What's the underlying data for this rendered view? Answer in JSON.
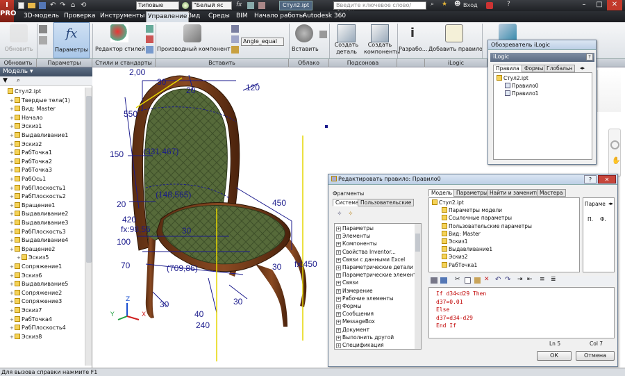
{
  "titlebar": {
    "logo": "I PRO",
    "combo_template": "Типовые",
    "combo_material": "\"Белый яс",
    "file_tab": "Стул2.ipt",
    "search_placeholder": "Введите ключевое слово/фразу",
    "login": "Вход"
  },
  "menu": [
    "3D-модель",
    "Проверка",
    "Инструменты",
    "Управление",
    "Вид",
    "Среды",
    "BIM",
    "Начало работы",
    "Autodesk 360"
  ],
  "menu_active": "Управление",
  "ribbon": {
    "buttons": {
      "update": "Обновить",
      "params": "Параметры",
      "style_editor": "Редактор стилей",
      "derive": "Производный компонент",
      "angle_equal": "Angle_equal",
      "insert": "Вставить",
      "create_part": "Создать деталь",
      "create_components": "Создать компоненты",
      "develop": "Разрабо...",
      "add_rule": "Добавить правило"
    },
    "groups": [
      "Обновить",
      "Параметры",
      "Стили и стандарты",
      "Вставить",
      "Облако точек",
      "Подсонова",
      "iLogic"
    ]
  },
  "tree": {
    "header": "Модель",
    "items": [
      "Стул2.ipt",
      "Твердые тела(1)",
      "Вид: Master",
      "Начало",
      "Эскиз1",
      "Выдавливание1",
      "Эскиз2",
      "РабТочка1",
      "РабТочка2",
      "РабТочка3",
      "РабОсь1",
      "РабПлоскость1",
      "РабПлоскость2",
      "Вращение1",
      "Выдавливание2",
      "Выдавливание3",
      "РабПлоскость3",
      "Выдавливание4",
      "Вращение2",
      "Эскиз5",
      "Сопряжение1",
      "Эскиз6",
      "Выдавливание5",
      "Сопряжение2",
      "Сопряжение3",
      "Эскиз7",
      "РабТочка4",
      "РабПлоскость4",
      "Эскиз8"
    ]
  },
  "dims": [
    "2,00",
    "30",
    "20",
    "120",
    "550",
    "150",
    "(331,467)",
    "(148,565)",
    "420",
    "20",
    "100",
    "fx:98,56",
    "450",
    "30",
    "70",
    "fx:450",
    "(709,86)",
    "30",
    "30",
    "240",
    "40",
    "30"
  ],
  "ilogic": {
    "title": "Обозреватель iLogic",
    "header": "iLogic",
    "tabs": [
      "Правила",
      "Формы",
      "Глобальн"
    ],
    "items": [
      "Стул2.ipt",
      "Правило0",
      "Правило1"
    ]
  },
  "rule_editor": {
    "title": "Редактировать правило: Правило0",
    "fragments_label": "Фрагменты",
    "left_tabs": [
      "Система",
      "Пользовательские"
    ],
    "snippets": [
      "Параметры",
      "Элементы",
      "Компоненты",
      "Свойства Inventor...",
      "Связи с данными Excel",
      "Параметрические детали",
      "Параметрические элементы",
      "Связи",
      "Измерение",
      "Рабочие элементы",
      "Формы",
      "Сообщения",
      "MessageBox",
      "Документ",
      "Выполнить другой",
      "Спецификация"
    ],
    "right_tabs": [
      "Модель",
      "Параметры",
      "Найти и заменить",
      "Мастера"
    ],
    "model_items": [
      "Стул2.ipt",
      "Параметры модели",
      "Ссылочные параметры",
      "Пользовательские параметры",
      "Вид: Master",
      "Эскиз1",
      "Выдавливание1",
      "Эскиз2",
      "РабТочка1"
    ],
    "param_header": "Параме",
    "param_cols": [
      "П.",
      "Ф."
    ],
    "code": [
      "If d34<d29 Then",
      "d37=0.01",
      "Else",
      "d37=d34-d29",
      "End If"
    ],
    "line": "Ln 5",
    "col": "Col 7",
    "ok": "ОК",
    "cancel": "Отмена"
  },
  "status": "Для вызова справки нажмите F1",
  "colors": {
    "code_keyword": "#c00000",
    "code_text": "#c00000",
    "dim": "#1a1a8c",
    "accent": "#3a6fb0"
  }
}
